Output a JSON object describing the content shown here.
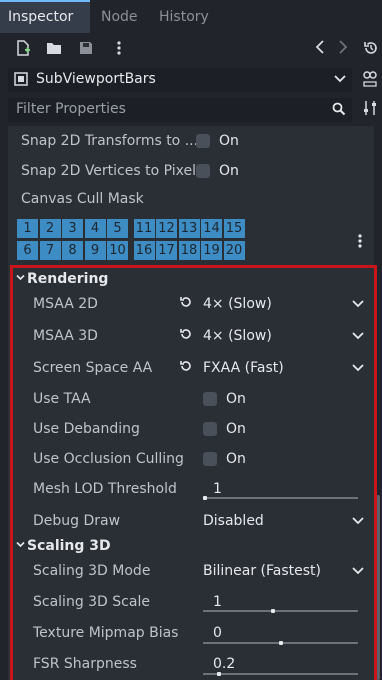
{
  "tabs": [
    {
      "label": "Inspector"
    },
    {
      "label": "Node"
    },
    {
      "label": "History"
    }
  ],
  "toolbar": {
    "icons": [
      "new-resource-icon",
      "open-folder-icon",
      "save-icon",
      "more-vertical-icon",
      "history-back-icon",
      "history-forward-icon",
      "history-icon"
    ]
  },
  "object": {
    "name": "SubViewportBars",
    "icon": "subviewport-icon"
  },
  "filter": {
    "placeholder": "Filter Properties"
  },
  "props_top": [
    {
      "label": "Snap 2D Transforms to ...",
      "value": "On"
    },
    {
      "label": "Snap 2D Vertices to Pixel",
      "value": "On"
    }
  ],
  "canvas_cull_mask": {
    "label": "Canvas Cull Mask",
    "row1": [
      "1",
      "2",
      "3",
      "4",
      "5",
      "11",
      "12",
      "13",
      "14",
      "15"
    ],
    "row2": [
      "6",
      "7",
      "8",
      "9",
      "10",
      "16",
      "17",
      "18",
      "19",
      "20"
    ]
  },
  "rendering": {
    "header": "Rendering",
    "msaa2d": {
      "label": "MSAA 2D",
      "value": "4× (Slow)"
    },
    "msaa3d": {
      "label": "MSAA 3D",
      "value": "4× (Slow)"
    },
    "ssaa": {
      "label": "Screen Space AA",
      "value": "FXAA (Fast)"
    },
    "taa": {
      "label": "Use TAA",
      "value": "On"
    },
    "debanding": {
      "label": "Use Debanding",
      "value": "On"
    },
    "occlusion": {
      "label": "Use Occlusion Culling",
      "value": "On"
    },
    "mesh_lod": {
      "label": "Mesh LOD Threshold",
      "value": "1"
    },
    "debug_draw": {
      "label": "Debug Draw",
      "value": "Disabled"
    }
  },
  "scaling": {
    "header": "Scaling 3D",
    "mode": {
      "label": "Scaling 3D Mode",
      "value": "Bilinear (Fastest)"
    },
    "scale": {
      "label": "Scaling 3D Scale",
      "value": "1",
      "level": 0.45
    },
    "mipmap": {
      "label": "Texture Mipmap Bias",
      "value": "0",
      "level": 0.5
    },
    "fsr": {
      "label": "FSR Sharpness",
      "value": "0.2",
      "level": 0.1
    }
  },
  "colors": {
    "accent": "#70bafa",
    "mask_bit": "#3e8cc4",
    "highlight": "#c8141b"
  }
}
